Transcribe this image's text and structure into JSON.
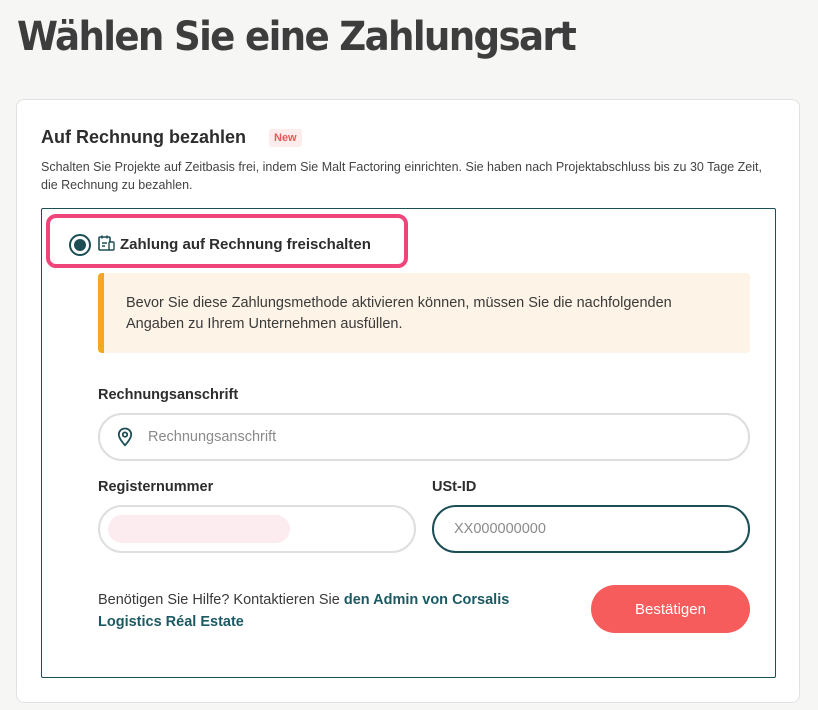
{
  "page": {
    "title": "Wählen Sie eine Zahlungsart"
  },
  "section": {
    "title": "Auf Rechnung bezahlen",
    "badge": "New",
    "description": "Schalten Sie Projekte auf Zeitbasis frei, indem Sie Malt Factoring einrichten. Sie haben nach Projektabschluss bis zu 30 Tage Zeit, die Rechnung zu bezahlen."
  },
  "option": {
    "label": "Zahlung auf Rechnung freischalten",
    "selected": true
  },
  "notice": {
    "text": "Bevor Sie diese Zahlungsmethode aktivieren können, müssen Sie die nachfolgenden Angaben zu Ihrem Unternehmen ausfüllen."
  },
  "form": {
    "address": {
      "label": "Rechnungsanschrift",
      "placeholder": "Rechnungsanschrift",
      "value": ""
    },
    "register": {
      "label": "Registernummer"
    },
    "vat": {
      "label": "USt-ID",
      "placeholder": "XX000000000",
      "value": ""
    }
  },
  "help": {
    "text": "Benötigen Sie Hilfe? Kontaktieren Sie ",
    "link": "den Admin von Corsalis Logistics Réal Estate"
  },
  "actions": {
    "confirm_label": "Bestätigen"
  },
  "colors": {
    "accent": "#1b4f55",
    "button": "#f75c5c",
    "highlight": "#f0457a",
    "notice_bar": "#f5a623"
  }
}
